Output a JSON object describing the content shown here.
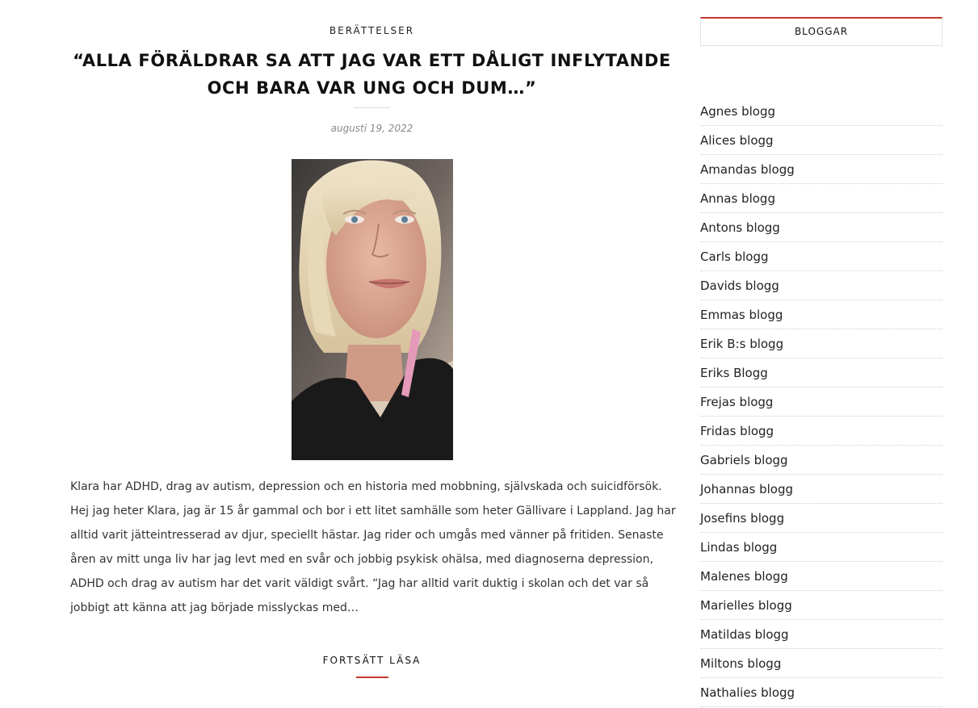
{
  "post": {
    "category": "BERÄTTELSER",
    "title": "“ALLA FÖRÄLDRAR SA ATT JAG VAR ETT DÅLIGT INFLYTANDE OCH BARA VAR UNG OCH DUM…”",
    "date": "augusti 19, 2022",
    "excerpt": "Klara har ADHD, drag av autism, depression och en historia med mobbning, självskada och suicidförsök.\nHej jag heter Klara, jag är 15 år gammal och bor i ett litet samhälle som heter Gällivare i Lappland.  Jag har\nalltid varit jätteintresserad av djur, speciellt hästar. Jag rider och umgås med vänner på fritiden. Senaste\nåren av mitt unga liv har jag levt med en svår och jobbig psykisk ohälsa, med diagnoserna depression,\nADHD och drag av autism har det varit väldigt svårt.  “Jag har alltid varit duktig i skolan och det var så\njobbigt att känna att jag började misslyckas med…",
    "continue_label": "FORTSÄTT LÄSA"
  },
  "sidebar": {
    "widget_title": "BLOGGAR",
    "blogs": [
      "Agnes blogg",
      "Alices blogg",
      "Amandas blogg",
      "Annas blogg",
      "Antons blogg",
      "Carls blogg",
      "Davids blogg",
      "Emmas blogg",
      "Erik B:s blogg",
      "Eriks Blogg",
      "Frejas blogg",
      "Fridas blogg",
      "Gabriels blogg",
      "Johannas blogg",
      "Josefins blogg",
      "Lindas blogg",
      "Malenes blogg",
      "Marielles blogg",
      "Matildas blogg",
      "Miltons blogg",
      "Nathalies blogg"
    ]
  },
  "colors": {
    "accent": "#c0392b",
    "text": "#222222",
    "meta": "#8a8a8a"
  }
}
